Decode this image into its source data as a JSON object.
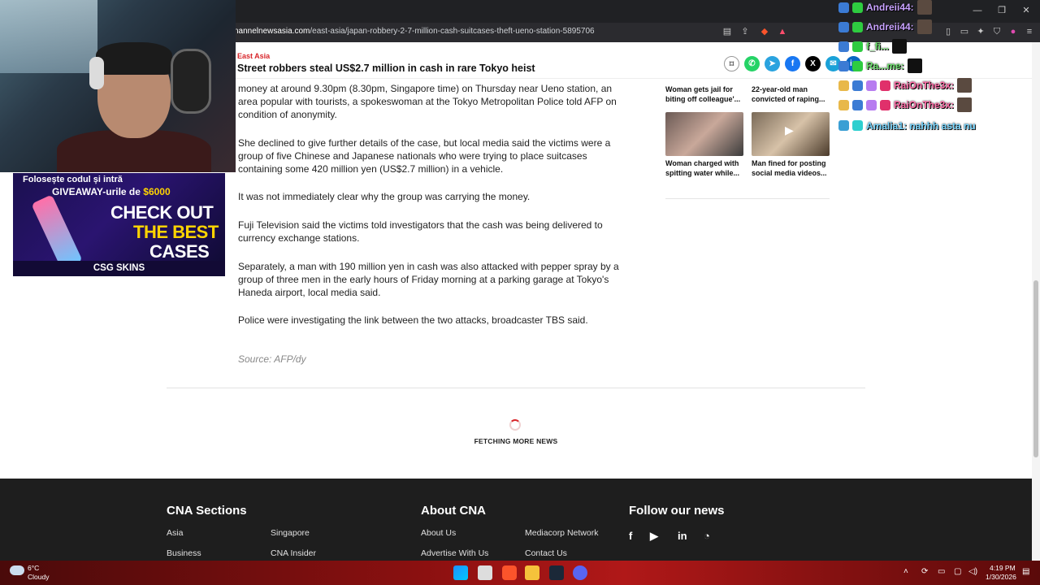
{
  "browser": {
    "url_domain": "nannelnewsasia.com",
    "url_path": "/east-asia/japan-robbery-2-7-million-cash-suitcases-theft-ueno-station-5895706"
  },
  "sticky_header": {
    "section": "East Asia",
    "headline": "Street robbers steal US$2.7 million in cash in rare Tokyo heist"
  },
  "article": {
    "paragraphs": [
      "money at around 9.30pm (8.30pm, Singapore time) on Thursday near Ueno station, an area popular with tourists, a spokeswoman at the Tokyo Metropolitan Police told AFP on condition of anonymity.",
      "She declined to give further details of the case, but local media said the victims were a group of five Chinese and Japanese nationals who were trying to place suitcases containing some 420 million yen (US$2.7 million) in a vehicle.",
      "It was not immediately clear why the group was carrying the money.",
      "Fuji Television said the victims told investigators that the cash was being delivered to currency exchange stations.",
      "Separately, a man with 190 million yen in cash was also attacked with pepper spray by a group of three men in the early hours of Friday morning at a parking garage at Tokyo's Haneda airport, local media said.",
      "Police were investigating the link between the two attacks, broadcaster TBS said."
    ],
    "source": "Source: AFP/dy",
    "loading_text": "FETCHING MORE NEWS"
  },
  "related": [
    {
      "title": "Woman gets jail for biting off colleague'..."
    },
    {
      "title": "22-year-old man convicted of raping..."
    },
    {
      "title": "Woman charged with spitting water while..."
    },
    {
      "title": "Man fined for posting social media videos..."
    }
  ],
  "footer": {
    "sections_heading": "CNA Sections",
    "sections_links": [
      "Asia",
      "Singapore",
      "Business",
      "CNA Insider"
    ],
    "about_heading": "About CNA",
    "about_links": [
      "About Us",
      "Mediacorp Network",
      "Advertise With Us",
      "Contact Us"
    ],
    "follow_heading": "Follow our news"
  },
  "promo": {
    "line1": "Folosește codul și intră",
    "line2_prefix": "GIVEAWAY-urile de ",
    "line2_amount": "$6000",
    "cta1": "CHECK OUT",
    "cta2": "THE BEST",
    "cta3": "CASES",
    "brand": "CSG SKINS"
  },
  "chat": [
    {
      "name": "Andreii44:",
      "color": "#c8a2ff"
    },
    {
      "name": "Andreii44:",
      "color": "#c8a2ff"
    },
    {
      "name": "f_fi...",
      "color": "#6ee06e"
    },
    {
      "name": "Ra...me:",
      "color": "#6ee06e"
    },
    {
      "name": "RaiOnThe3x:",
      "color": "#ff6ea8"
    },
    {
      "name": "RaiOnThe3x:",
      "color": "#ff6ea8"
    },
    {
      "name": "Amalia1: nahhh asta nu",
      "color": "#7ad7ff"
    }
  ],
  "taskbar": {
    "temp": "6°C",
    "condition": "Cloudy",
    "time": "4:19 PM",
    "date": "1/30/2026"
  }
}
